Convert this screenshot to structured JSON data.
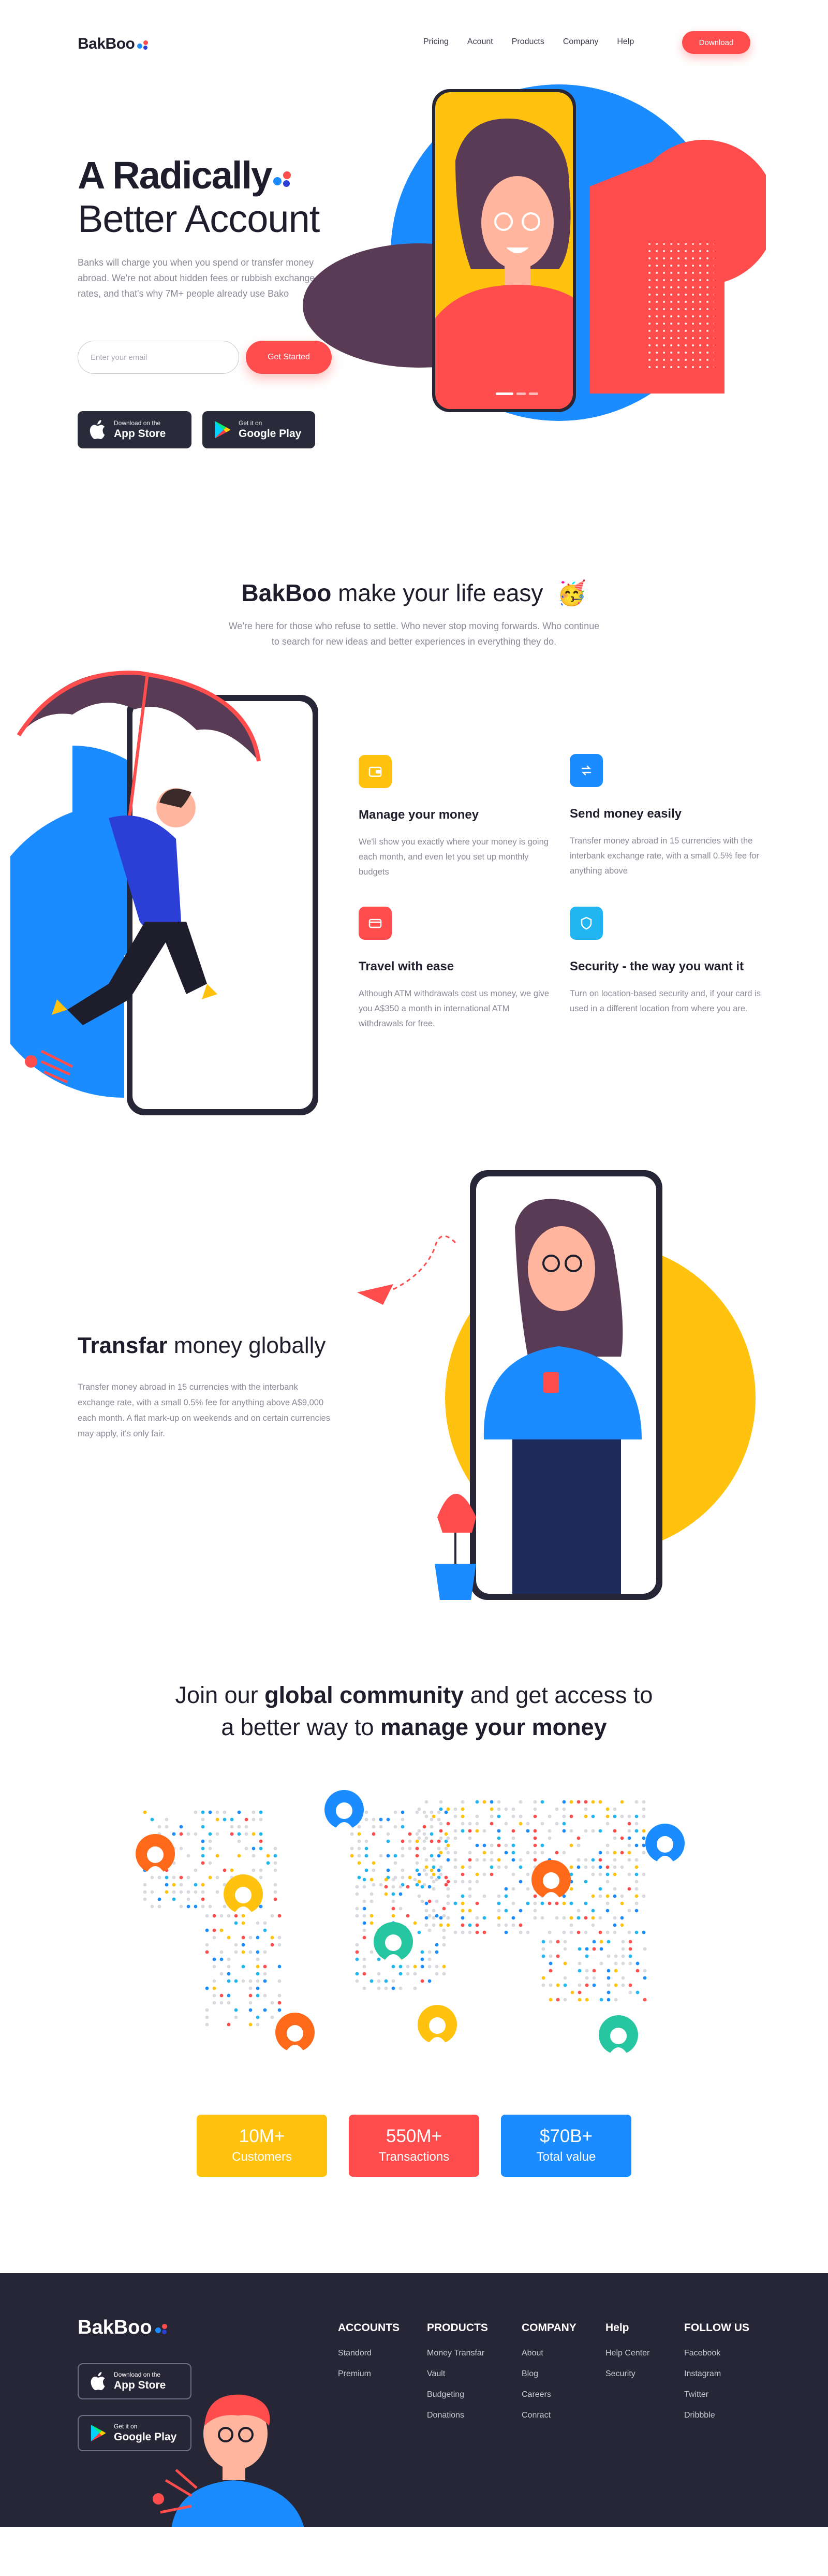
{
  "brand": {
    "name": "BakBoo",
    "accent": "#ff4d4d",
    "dark": "#262636",
    "blue": "#1a8cff",
    "yellow": "#ffc20f"
  },
  "nav": {
    "items": [
      "Pricing",
      "Acount",
      "Products",
      "Company",
      "Help"
    ],
    "cta": "Download"
  },
  "hero": {
    "title_bold": "A Radically",
    "title_light": "Better Account",
    "description": "Banks will charge you when you spend or transfer money abroad. We're not about hidden fees or rubbish exchange rates, and that's why 7M+ people already use Bako",
    "email_placeholder": "Enter your email",
    "cta": "Get Started",
    "app_store": {
      "top": "Download on the",
      "bottom": "App Store",
      "icon": "apple-icon"
    },
    "google_play": {
      "top": "Get it on",
      "bottom": "Google Play",
      "icon": "google-play-icon"
    }
  },
  "life": {
    "title_bold": "BakBoo",
    "title_light": "make your life easy",
    "emoji": "🥳",
    "description_line1": "We're here for those who refuse to settle. Who never stop moving forwards. Who continue",
    "description_line2": "to search for new ideas and better experiences in everything they do.",
    "features": [
      {
        "icon": "wallet-icon",
        "color": "#ffc20f",
        "title": "Manage your money",
        "text": "We'll show you exactly where your money is going each month, and even let you set up monthly budgets"
      },
      {
        "icon": "transfer-icon",
        "color": "#1a8cff",
        "title": "Send money easily",
        "text": "Transfer money abroad in 15 currencies with the interbank exchange rate, with a small 0.5% fee for anything above"
      },
      {
        "icon": "card-icon",
        "color": "#ff4d4d",
        "title": "Travel with ease",
        "text": "Although ATM withdrawals cost us money, we give you A$350 a month in international ATM withdrawals for free."
      },
      {
        "icon": "shield-icon",
        "color": "#21b6f2",
        "title": "Security - the way you want it",
        "text": "Turn on location-based security and, if your card is used in a different location from where you are."
      }
    ]
  },
  "global": {
    "title_bold": "Transfar",
    "title_light": "money globally",
    "description": "Transfer money abroad in 15 currencies with the interbank exchange rate, with a small 0.5% fee for anything above A$9,000 each month. A flat mark-up on weekends and on certain currencies may apply, it's only fair."
  },
  "community": {
    "line1_a": "Join our",
    "line1_b": "global community",
    "line1_c": "and get access to",
    "line2_a": "a better way to",
    "line2_b": "manage your money",
    "stats": [
      {
        "value": "10M+",
        "label": "Customers",
        "color": "#ffc20f"
      },
      {
        "value": "550M+",
        "label": "Transactions",
        "color": "#ff4d4d"
      },
      {
        "value": "$70B+",
        "label": "Total value",
        "color": "#1a8cff"
      }
    ]
  },
  "footer": {
    "brand": "BakBoo",
    "app_store": {
      "top": "Download on the",
      "bottom": "App Store"
    },
    "google_play": {
      "top": "Get it on",
      "bottom": "Google Play"
    },
    "columns": [
      {
        "title": "ACCOUNTS",
        "links": [
          "Standord",
          "Premium"
        ]
      },
      {
        "title": "PRODUCTS",
        "links": [
          "Money Transfar",
          "Vault",
          "Budgeting",
          "Donations"
        ]
      },
      {
        "title": "COMPANY",
        "links": [
          "About",
          "Blog",
          "Careers",
          "Conract"
        ]
      },
      {
        "title": "Help",
        "links": [
          "Help Center",
          "Security"
        ]
      },
      {
        "title": "FOLLOW US",
        "links": [
          "Facebook",
          "Instagram",
          "Twitter",
          "Dribbble"
        ]
      }
    ]
  }
}
